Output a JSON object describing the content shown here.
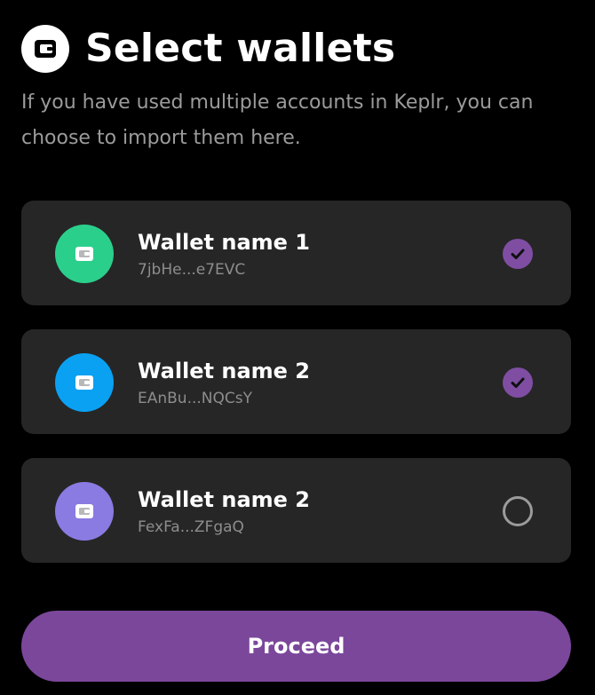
{
  "header": {
    "title": "Select wallets",
    "icon": "wallet-icon",
    "subtitle": "If you have used multiple accounts in Keplr, you can choose to import them here."
  },
  "wallets": [
    {
      "name": "Wallet name 1",
      "address": "7jbHe...e7EVC",
      "avatar_color": "#2bcf8c",
      "icon": "wallet-icon",
      "selected": true
    },
    {
      "name": "Wallet name 2",
      "address": "EAnBu...NQCsY",
      "avatar_color": "#0aa1f2",
      "icon": "wallet-icon",
      "selected": true
    },
    {
      "name": "Wallet name 2",
      "address": "FexFa...ZFgaQ",
      "avatar_color": "#8a7be3",
      "icon": "wallet-icon",
      "selected": false
    }
  ],
  "proceed": {
    "label": "Proceed"
  },
  "colors": {
    "background": "#000000",
    "card": "#262626",
    "accent": "#7b479b",
    "check": "#7f4ea3",
    "subtitle": "#9b9b9b"
  }
}
